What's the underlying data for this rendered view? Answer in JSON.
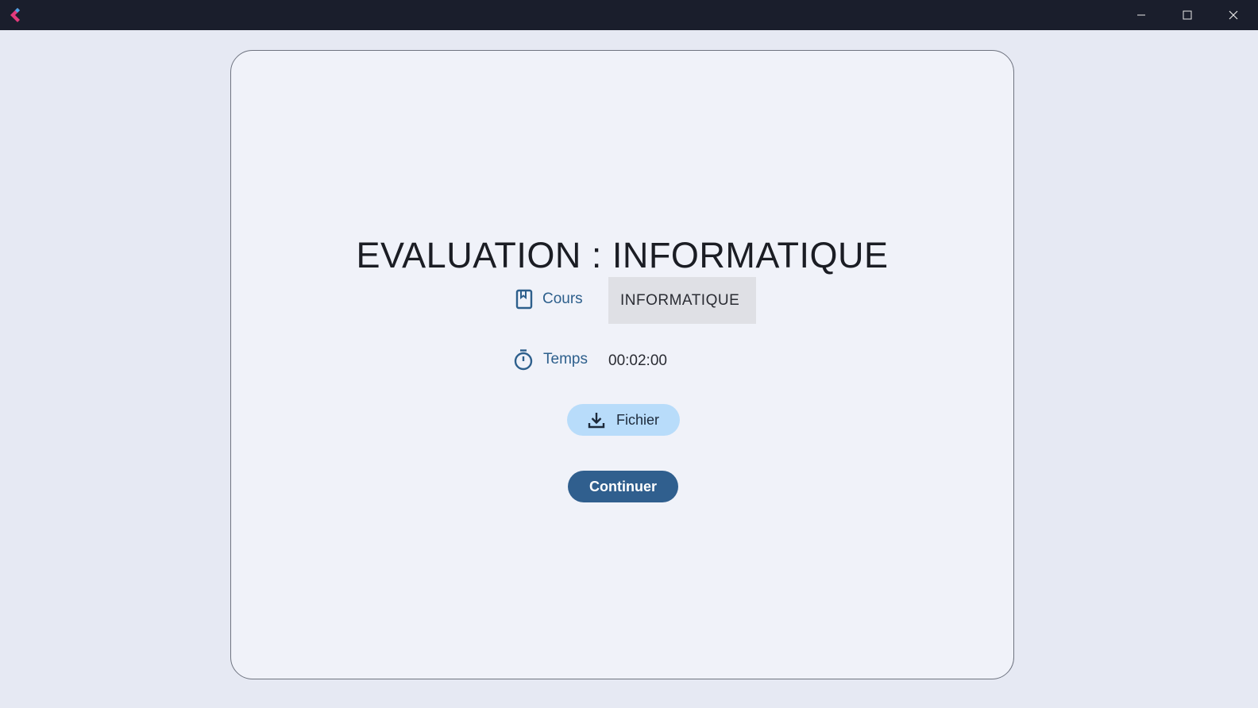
{
  "window": {
    "controls": {
      "minimize_icon": "minimize-icon",
      "maximize_icon": "maximize-icon",
      "close_icon": "close-icon"
    }
  },
  "main": {
    "title": "EVALUATION : INFORMATIQUE",
    "cours": {
      "label": "Cours",
      "value": "INFORMATIQUE",
      "icon": "book-icon"
    },
    "temps": {
      "label": "Temps",
      "value": "00:02:00",
      "icon": "timer-icon"
    },
    "fichier_button": {
      "label": "Fichier",
      "icon": "download-icon"
    },
    "continuer_button": {
      "label": "Continuer"
    }
  },
  "colors": {
    "accent": "#305f8e",
    "label": "#2d5f8c",
    "fichier_bg": "#b8dcfa",
    "titlebar": "#1a1e2c"
  }
}
